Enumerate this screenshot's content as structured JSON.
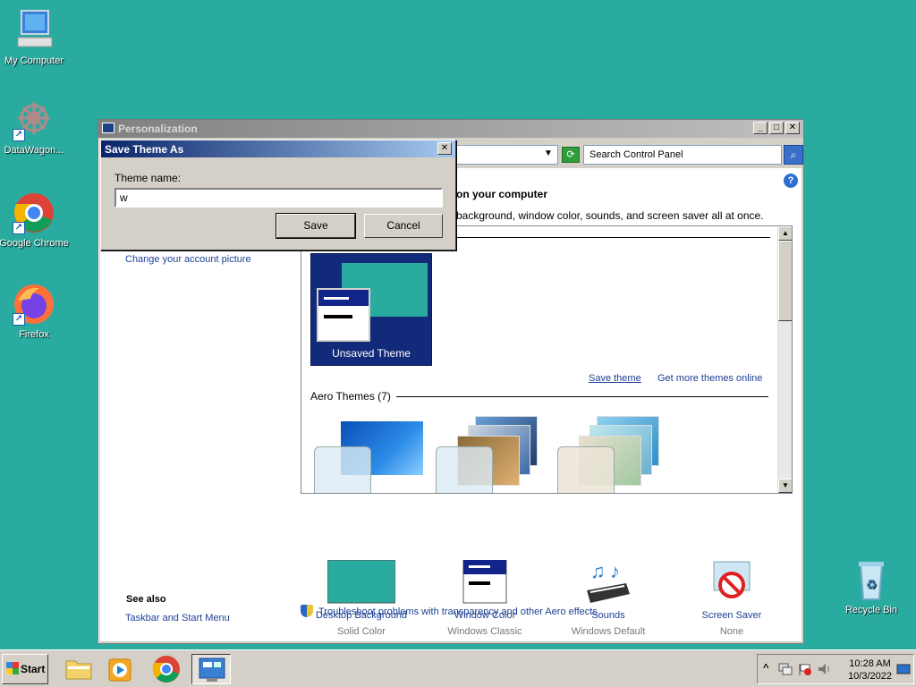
{
  "desktop": {
    "icons": [
      {
        "label": "My Computer"
      },
      {
        "label": "DataWagon..."
      },
      {
        "label": "Google Chrome"
      },
      {
        "label": "Firefox"
      },
      {
        "label": "Recycle Bin"
      }
    ]
  },
  "window": {
    "title": "Personalization",
    "min": "_",
    "max": "□",
    "close": "✕",
    "search_placeholder": "Search Control Panel",
    "help": "?",
    "heading": "on your computer",
    "subtext": "background, window color, sounds, and screen saver all at once.",
    "side_link": "Change your account picture",
    "see_also_title": "See also",
    "see_also_link": "Taskbar and Start Menu",
    "selected_theme": "Unsaved Theme",
    "save_theme": "Save theme",
    "more_themes": "Get more themes online",
    "aero_themes": "Aero Themes (7)",
    "tools": [
      {
        "label": "Desktop Background",
        "value": "Solid Color"
      },
      {
        "label": "Window Color",
        "value": "Windows Classic"
      },
      {
        "label": "Sounds",
        "value": "Windows Default"
      },
      {
        "label": "Screen Saver",
        "value": "None"
      }
    ],
    "troubleshoot": "Troubleshoot problems with transparency and other Aero effects"
  },
  "dialog": {
    "title": "Save Theme As",
    "close": "✕",
    "label": "Theme name:",
    "value": "w",
    "save": "Save",
    "cancel": "Cancel"
  },
  "taskbar": {
    "start": "Start",
    "tray_chevron": "^",
    "time": "10:28 AM",
    "date": "10/3/2022"
  },
  "colors": {
    "desktop": "#2aaba0",
    "dialog_title": "#0a246a",
    "link": "#1b3f94"
  }
}
